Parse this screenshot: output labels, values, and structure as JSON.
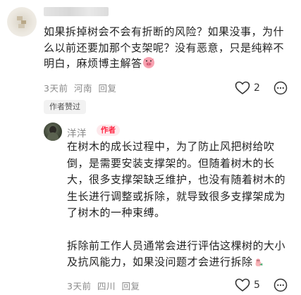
{
  "comment": {
    "lines": [
      "如果拆掉树会不会有折断的风险？如果没事，为什",
      "么以前还要加那个支架呢？没有恶意，只是纯粹不",
      "明白，麻烦博主解答"
    ],
    "meta": {
      "time": "3天前",
      "location": "河南",
      "reply_label": "回复"
    },
    "like_count": "2",
    "liked_by_author_badge": "作者赞过"
  },
  "reply": {
    "author_name": "洋洋",
    "author_badge": "作者",
    "paragraph1": [
      "在树木的成长过程中，为了防止风把树给吹",
      "倒，是需要安装支撑架的。但随着树木的长",
      "大，很多支撑架缺乏维护，也没有随着树木的",
      "生长进行调整或拆除，就导致很多支撑架成为",
      "了树木的一种束缚。"
    ],
    "paragraph2": [
      "拆除前工作人员通常会进行评估这棵树的大小",
      "及抗风能力，如果没问题才会进行拆除"
    ],
    "meta": {
      "time": "3天前",
      "location": "四川",
      "reply_label": "回复"
    },
    "like_count": "5"
  },
  "icons": {
    "heart": "heart-outline-icon",
    "comment": "comment-bubble-icon",
    "emoji_pig": "pig-face-emoji",
    "emoji_tail": "hand-sticker-emoji"
  },
  "colors": {
    "author_badge_bg": "#fde9ec",
    "author_badge_text": "#ff2442",
    "meta_gray": "#8a8a8a"
  }
}
